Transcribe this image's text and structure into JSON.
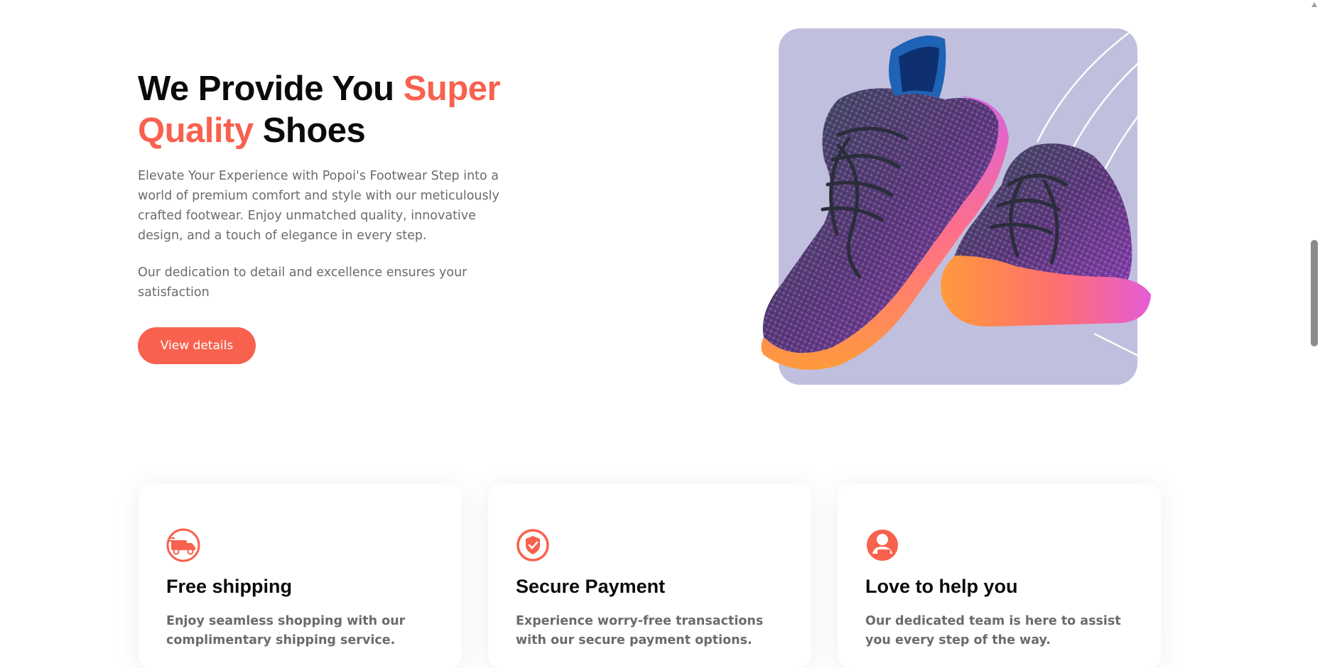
{
  "hero": {
    "title_part1": "We Provide You ",
    "title_accent1": "Super",
    "title_accent2": "Quality",
    "title_part2": " Shoes",
    "description": "Elevate Your Experience with Popoi's Footwear Step into a world of premium comfort and style with our meticulously crafted footwear. Enjoy unmatched quality, innovative design, and a touch of elegance in every step.",
    "description2": "Our dedication to detail and excellence ensures your satisfaction",
    "button_label": "View details"
  },
  "features": [
    {
      "icon": "delivery-truck-icon",
      "title": "Free shipping",
      "text": "Enjoy seamless shopping with our complimentary shipping service."
    },
    {
      "icon": "shield-check-icon",
      "title": "Secure Payment",
      "text": "Experience worry-free transactions with our secure payment options."
    },
    {
      "icon": "support-agent-icon",
      "title": "Love to help you",
      "text": "Our dedicated team is here to assist you every step of the way."
    }
  ],
  "colors": {
    "accent": "#f8614e",
    "image_background": "#c0c0de",
    "text_muted": "#6b6b6b"
  }
}
